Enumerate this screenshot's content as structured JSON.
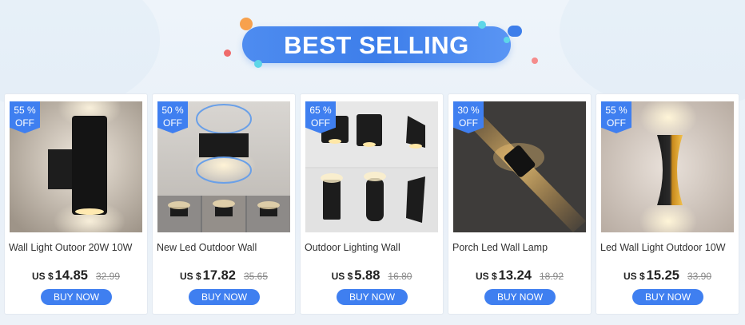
{
  "banner": {
    "title": "BEST SELLING"
  },
  "colors": {
    "accent": "#3f7ff0",
    "banner": "#4e8cf0"
  },
  "products": [
    {
      "badge_line1": "55 %",
      "badge_line2": "OFF",
      "name": "Wall Light Outoor 20W 10W",
      "currency": "US $",
      "price": "14.85",
      "old_price": "32.99",
      "button": "BUY NOW"
    },
    {
      "badge_line1": "50 %",
      "badge_line2": "OFF",
      "name": "New Led Outdoor Wall",
      "currency": "US $",
      "price": "17.82",
      "old_price": "35.65",
      "button": "BUY NOW"
    },
    {
      "badge_line1": "65 %",
      "badge_line2": "OFF",
      "name": "Outdoor Lighting Wall",
      "currency": "US $",
      "price": "5.88",
      "old_price": "16.80",
      "button": "BUY NOW"
    },
    {
      "badge_line1": "30 %",
      "badge_line2": "OFF",
      "name": "Porch Led Wall Lamp",
      "currency": "US $",
      "price": "13.24",
      "old_price": "18.92",
      "button": "BUY NOW"
    },
    {
      "badge_line1": "55 %",
      "badge_line2": "OFF",
      "name": "Led Wall Light Outdoor 10W",
      "currency": "US $",
      "price": "15.25",
      "old_price": "33.90",
      "button": "BUY NOW"
    }
  ]
}
